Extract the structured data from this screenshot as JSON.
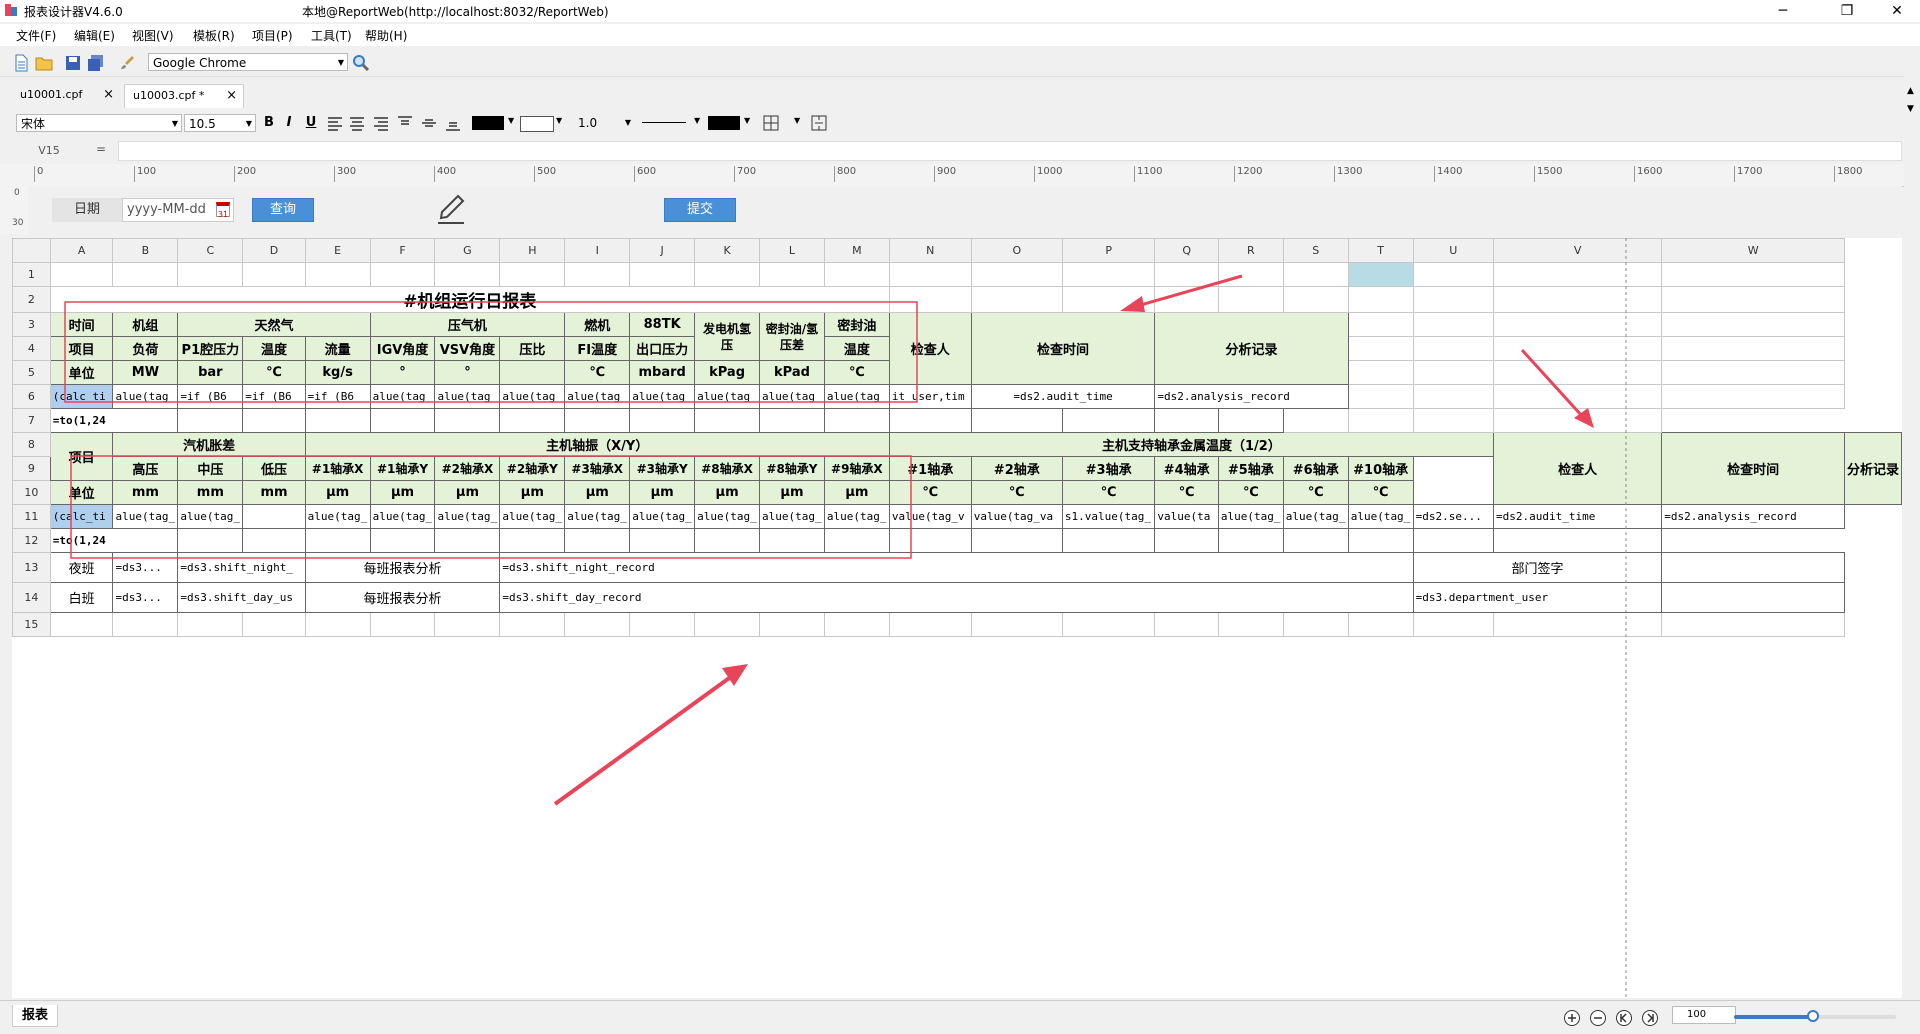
{
  "app_title": "报表设计器V4.6.0",
  "window_title": "本地@ReportWeb(http://localhost:8032/ReportWeb)",
  "menu": [
    "文件(F)",
    "编辑(E)",
    "视图(V)",
    "模板(R)",
    "项目(P)",
    "工具(T)",
    "帮助(H)"
  ],
  "toolbar": {
    "browser_select": "Google Chrome"
  },
  "tabs": [
    {
      "label": "u10001.cpf"
    },
    {
      "label": "u10003.cpf *"
    }
  ],
  "format_bar": {
    "font": "宋体",
    "font_size": "10.5",
    "bold": "B",
    "italic": "I",
    "underline": "U",
    "line_width": "1.0"
  },
  "formula_bar": {
    "cell_ref": "V15",
    "equals": "="
  },
  "ruler": [
    "0",
    "100",
    "200",
    "300",
    "400",
    "500",
    "600",
    "700",
    "800",
    "900",
    "1000",
    "1100",
    "1200",
    "1300",
    "1400",
    "1500",
    "1600",
    "1700",
    "1800"
  ],
  "vruler": [
    "0",
    "30"
  ],
  "params": {
    "date_label": "日期",
    "date_placeholder": "yyyy-MM-dd",
    "calendar_day": "31",
    "query_button": "查询",
    "submit_button": "提交"
  },
  "columns": [
    "A",
    "B",
    "C",
    "D",
    "E",
    "F",
    "G",
    "H",
    "I",
    "J",
    "K",
    "L",
    "M",
    "N",
    "O",
    "P",
    "Q",
    "R",
    "S",
    "T",
    "U",
    "V",
    "W"
  ],
  "rows": [
    "1",
    "2",
    "3",
    "4",
    "5",
    "6",
    "7",
    "8",
    "9",
    "10",
    "11",
    "12",
    "13",
    "14",
    "15"
  ],
  "report": {
    "title": "#机组运行日报表",
    "r3": {
      "a": "时间",
      "b": "机组",
      "cde": "天然气",
      "fgh": "压气机",
      "i": "燃机",
      "j": "88TK",
      "k": "发电机氢压",
      "l": "密封油/氢压差",
      "m": "密封油",
      "n": "检查人",
      "op": "检查时间",
      "qrs": "分析记录"
    },
    "r4": {
      "a": "项目",
      "b": "负荷",
      "c": "P1腔压力",
      "d": "温度",
      "e": "流量",
      "f": "IGV角度",
      "g": "VSV角度",
      "h": "压比",
      "i": "FI温度",
      "j": "出口压力",
      "m": "温度"
    },
    "r5": {
      "a": "单位",
      "b": "MW",
      "c": "bar",
      "d": "℃",
      "e": "kg/s",
      "f": "°",
      "g": "°",
      "i": "℃",
      "j": "mbard",
      "k": "kPag",
      "l": "kPad",
      "m": "℃"
    },
    "r6": {
      "a": "(calc_ti",
      "b": "alue(tag_",
      "c": "=if (B6",
      "d": "=if (B6",
      "e": "=if (B6",
      "f": "alue(tag_",
      "g": "alue(tag_",
      "h": "alue(tag_",
      "i": "alue(tag_",
      "j": "alue(tag_",
      "k": "alue(tag_",
      "l": "alue(tag_",
      "m": "alue(tag_",
      "n": "it_user,tim",
      "op": "=ds2.audit_time",
      "qrs": "=ds2.analysis_record"
    },
    "r7": {
      "a": "=to(1,24"
    },
    "r8": {
      "a": "项目",
      "bcd": "汽机胀差",
      "e_m": "主机轴振（X/Y）",
      "n_t": "主机支持轴承金属温度（1/2）",
      "u": "检查人",
      "v": "检查时间",
      "w": "分析记录"
    },
    "r9": {
      "b": "高压",
      "c": "中压",
      "d": "低压",
      "e": "#1轴承X",
      "f": "#1轴承Y",
      "g": "#2轴承X",
      "h": "#2轴承Y",
      "i": "#3轴承X",
      "j": "#3轴承Y",
      "k": "#8轴承X",
      "l": "#8轴承Y",
      "m": "#9轴承X",
      "n": "#1轴承",
      "o": "#2轴承",
      "p": "#3轴承",
      "q": "#4轴承",
      "r": "#5轴承",
      "s": "#6轴承",
      "t": "#10轴承"
    },
    "r10": {
      "a": "单位",
      "mm": "mm",
      "um": "μm",
      "deg": "℃"
    },
    "r11": {
      "a": "(calc_ti",
      "b": "alue(tag_",
      "c": "alue(tag_",
      "e": "alue(tag_",
      "f": "alue(tag_",
      "g": "alue(tag_",
      "h": "alue(tag_",
      "i": "alue(tag_",
      "j": "alue(tag_",
      "k": "alue(tag_",
      "l": "alue(tag_",
      "m": "alue(tag_",
      "n": "value(tag_v",
      "o": "value(tag_va",
      "p": "s1.value(tag_",
      "q": "value(ta",
      "r": "alue(tag_",
      "s": "alue(tag_",
      "t": "alue(tag_",
      "u": "=ds2.se...",
      "v": "=ds2.audit_time",
      "w": "=ds2.analysis_record"
    },
    "r12": {
      "a": "=to(1,24"
    },
    "r13": {
      "a": "夜班",
      "b": "=ds3...",
      "cd": "=ds3.shift_night_",
      "efg": "每班报表分析",
      "h_t": "=ds3.shift_night_record",
      "uv": "部门签字"
    },
    "r14": {
      "a": "白班",
      "b": "=ds3...",
      "cd": "=ds3.shift_day_us",
      "efg": "每班报表分析",
      "h_t": "=ds3.shift_day_record",
      "uv": "=ds3.department_user"
    }
  },
  "bottom": {
    "sheet_tab": "报表",
    "zoom_value": "100"
  },
  "colors": {
    "header_green": "#e4f2d8",
    "accent_blue": "#4a90d9",
    "annotation_red": "#e8445a"
  }
}
